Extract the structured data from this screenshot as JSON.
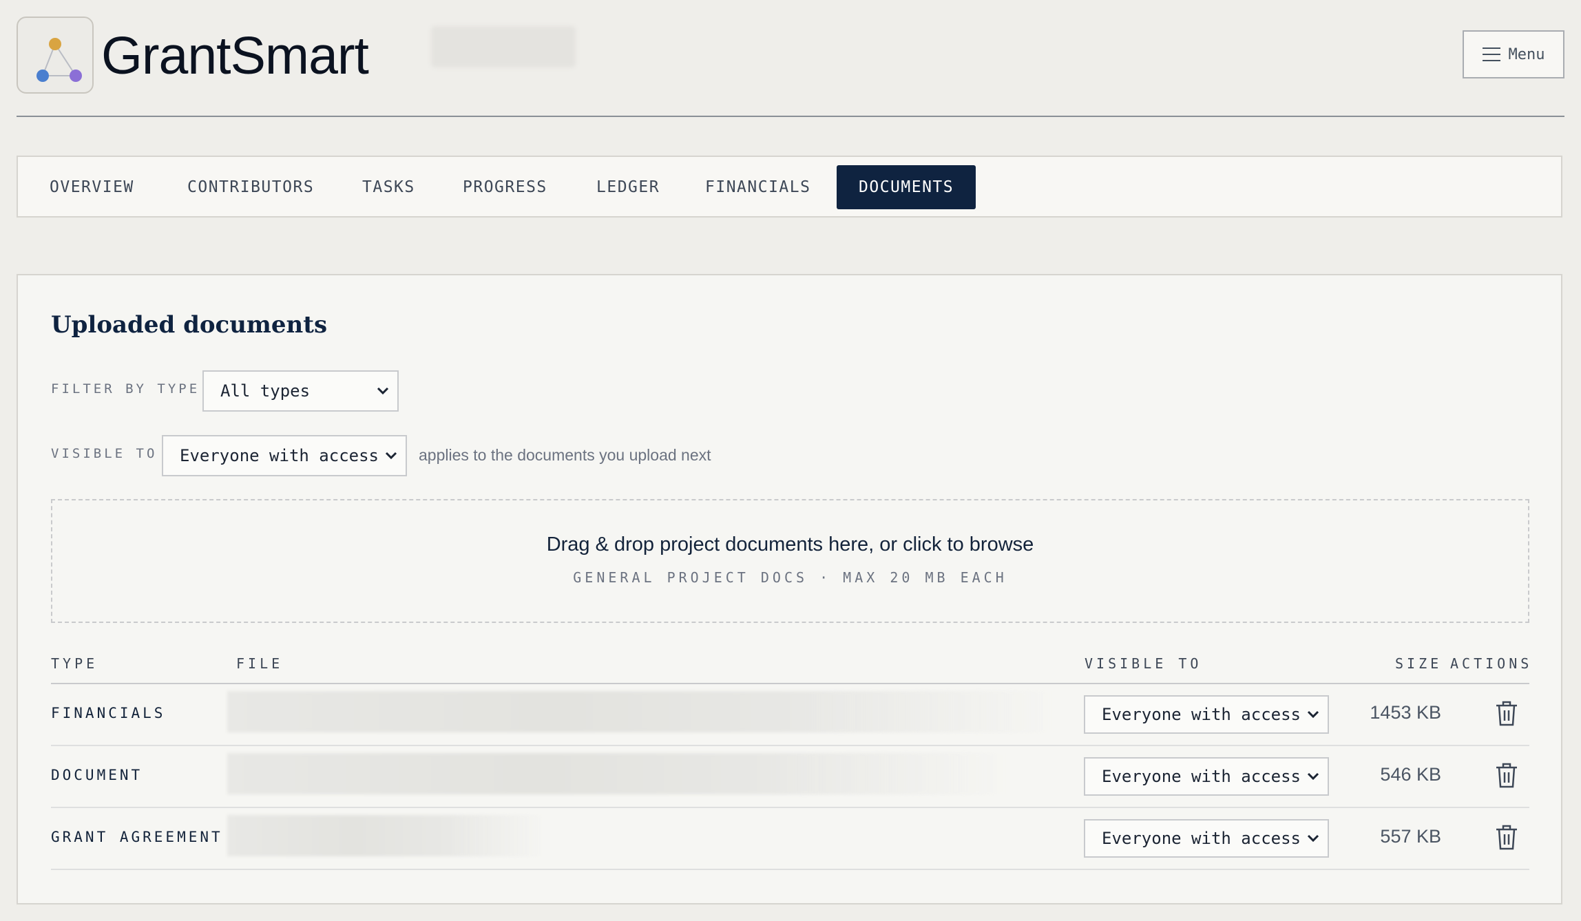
{
  "header": {
    "brand": "GrantSmart",
    "menu_label": "Menu"
  },
  "tabs": [
    {
      "label": "OVERVIEW"
    },
    {
      "label": "CONTRIBUTORS"
    },
    {
      "label": "TASKS"
    },
    {
      "label": "PROGRESS"
    },
    {
      "label": "LEDGER"
    },
    {
      "label": "FINANCIALS"
    },
    {
      "label": "DOCUMENTS",
      "active": true
    }
  ],
  "panel": {
    "title": "Uploaded documents",
    "filter_label": "FILTER BY TYPE",
    "filter_value": "All types",
    "visible_label": "VISIBLE TO",
    "visible_value": "Everyone with access",
    "visible_hint": "applies to the documents you upload next",
    "dropzone_main": "Drag & drop project documents here, or click to browse",
    "dropzone_sub": "GENERAL PROJECT DOCS · MAX 20 MB EACH"
  },
  "table": {
    "headers": {
      "type": "TYPE",
      "file": "FILE",
      "visible": "VISIBLE TO",
      "size": "SIZE",
      "actions": "ACTIONS"
    },
    "rows": [
      {
        "type": "FINANCIALS",
        "visible": "Everyone with access",
        "size": "1453 KB"
      },
      {
        "type": "DOCUMENT",
        "visible": "Everyone with access",
        "size": "546 KB"
      },
      {
        "type": "GRANT AGREEMENT",
        "visible": "Everyone with access",
        "size": "557 KB"
      }
    ]
  },
  "colors": {
    "accent": "#0f2340",
    "background": "#efeeea",
    "logo_top": "#d9a441",
    "logo_left": "#4a7fcf",
    "logo_right": "#8b6fd6"
  }
}
